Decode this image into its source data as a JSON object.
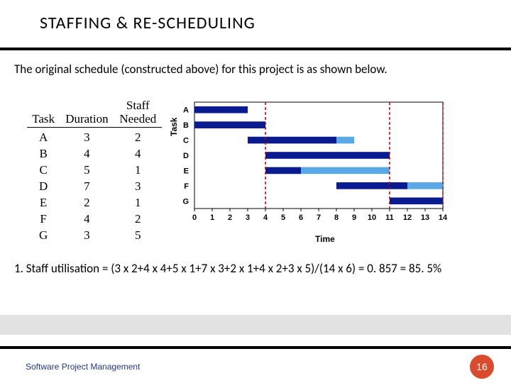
{
  "title": "STAFFING & RE-SCHEDULING",
  "intro": "The original schedule (constructed above) for this project is as shown below.",
  "table": {
    "headers": {
      "task": "Task",
      "duration": "Duration",
      "staff": "Staff\nNeeded"
    },
    "rows": [
      {
        "task": "A",
        "duration": "3",
        "staff": "2"
      },
      {
        "task": "B",
        "duration": "4",
        "staff": "4"
      },
      {
        "task": "C",
        "duration": "5",
        "staff": "1"
      },
      {
        "task": "D",
        "duration": "7",
        "staff": "3"
      },
      {
        "task": "E",
        "duration": "2",
        "staff": "1"
      },
      {
        "task": "F",
        "duration": "4",
        "staff": "2"
      },
      {
        "task": "G",
        "duration": "3",
        "staff": "5"
      }
    ]
  },
  "chart_data": {
    "type": "bar",
    "title": "",
    "xlabel": "Time",
    "ylabel": "Task",
    "categories": [
      "A",
      "B",
      "C",
      "D",
      "E",
      "F",
      "G"
    ],
    "x": [
      0,
      1,
      2,
      3,
      4,
      5,
      6,
      7,
      8,
      9,
      10,
      11,
      12,
      13,
      14
    ],
    "xlim": [
      0,
      14
    ],
    "series": [
      {
        "name": "A",
        "start": 0,
        "end": 3,
        "float_end": 3
      },
      {
        "name": "B",
        "start": 0,
        "end": 4,
        "float_end": 4
      },
      {
        "name": "C",
        "start": 3,
        "end": 8,
        "float_end": 9
      },
      {
        "name": "D",
        "start": 4,
        "end": 11,
        "float_end": 11
      },
      {
        "name": "E",
        "start": 4,
        "end": 6,
        "float_end": 11
      },
      {
        "name": "F",
        "start": 8,
        "end": 12,
        "float_end": 14
      },
      {
        "name": "G",
        "start": 11,
        "end": 14,
        "float_end": 14
      }
    ],
    "vlines": [
      4,
      11,
      14
    ],
    "colors": {
      "bar": "#0a1a8f",
      "float": "#5aa9e6",
      "vline": "#c00000"
    }
  },
  "calc": "1. Staff utilisation = (3 x 2+4 x 4+5 x 1+7 x 3+2 x 1+4 x 2+3 x 5)/(14 x 6) = 0. 857 = 85. 5%",
  "footer": "Software Project Management",
  "page": "16"
}
